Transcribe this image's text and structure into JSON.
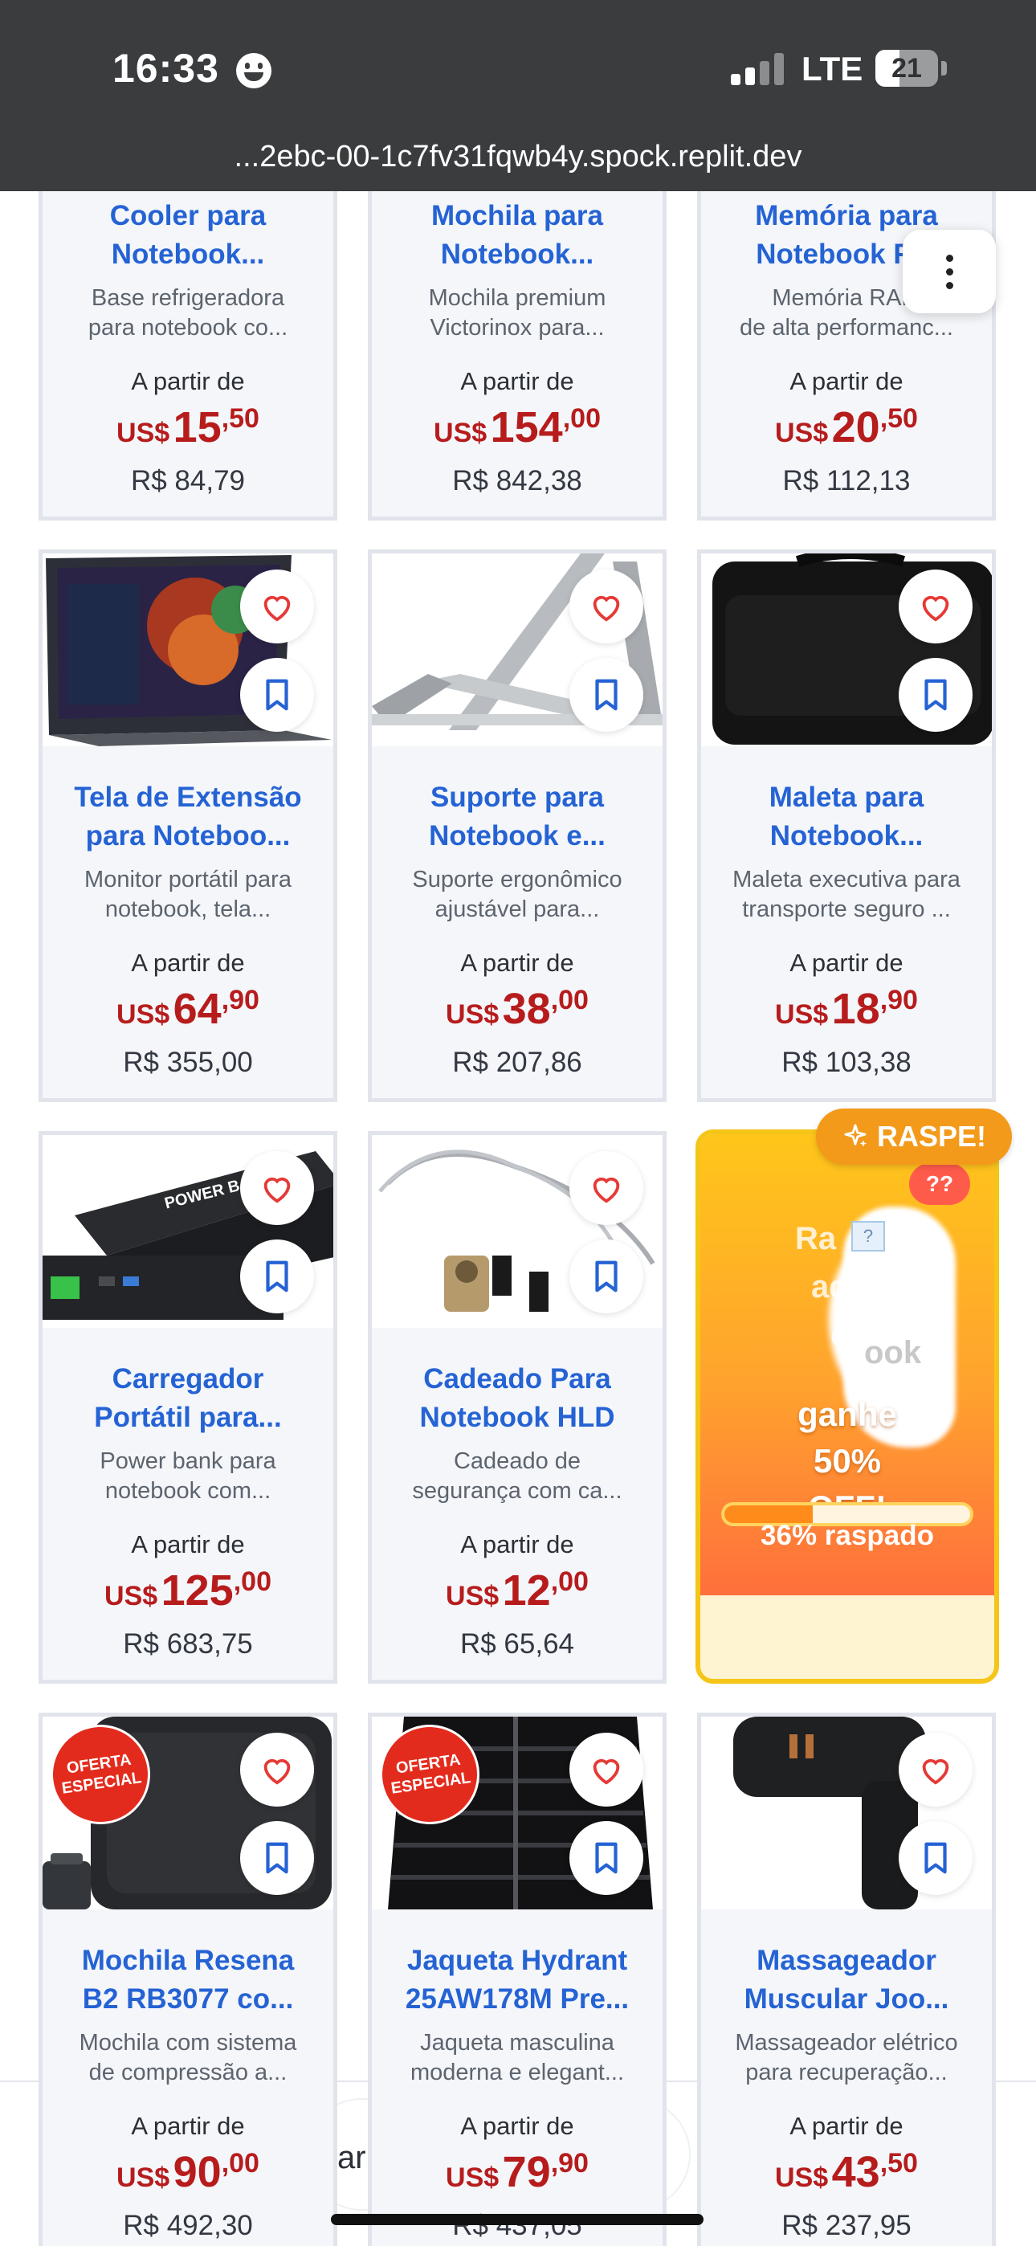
{
  "status_bar": {
    "time": "16:33",
    "network": "LTE",
    "battery": "21"
  },
  "browser": {
    "url": "...2ebc-00-1c7fv31fqwb4y.spock.replit.dev"
  },
  "common": {
    "price_prefix": "A partir de",
    "currency_usd": "US$"
  },
  "products": [
    {
      "title_l1": "Cooler para",
      "title_l2": "Notebook...",
      "desc_l1": "Base refrigeradora",
      "desc_l2": "para notebook co...",
      "usd_int": "15",
      "usd_cents": ",50",
      "brl": "R$ 84,79"
    },
    {
      "title_l1": "Mochila para",
      "title_l2": "Notebook...",
      "desc_l1": "Mochila premium",
      "desc_l2": "Victorinox para...",
      "usd_int": "154",
      "usd_cents": ",00",
      "brl": "R$ 842,38"
    },
    {
      "title_l1": "Memória para",
      "title_l2": "Notebook R...",
      "desc_l1": "Memória RAM",
      "desc_l2": "de alta performanc...",
      "usd_int": "20",
      "usd_cents": ",50",
      "brl": "R$ 112,13"
    },
    {
      "title_l1": "Tela de Extensão",
      "title_l2": "para Noteboo...",
      "desc_l1": "Monitor portátil para",
      "desc_l2": "notebook, tela...",
      "usd_int": "64",
      "usd_cents": ",90",
      "brl": "R$ 355,00",
      "image": "portable-monitor"
    },
    {
      "title_l1": "Suporte para",
      "title_l2": "Notebook e...",
      "desc_l1": "Suporte ergonômico",
      "desc_l2": "ajustável para...",
      "usd_int": "38",
      "usd_cents": ",00",
      "brl": "R$ 207,86",
      "image": "laptop-stand"
    },
    {
      "title_l1": "Maleta para",
      "title_l2": "Notebook...",
      "desc_l1": "Maleta executiva para",
      "desc_l2": "transporte seguro ...",
      "usd_int": "18",
      "usd_cents": ",90",
      "brl": "R$ 103,38",
      "image": "laptop-briefcase"
    },
    {
      "title_l1": "Carregador",
      "title_l2": "Portátil para...",
      "desc_l1": "Power bank para",
      "desc_l2": "notebook com...",
      "usd_int": "125",
      "usd_cents": ",00",
      "brl": "R$ 683,75",
      "image": "power-bank",
      "image_text": "POWER BANK"
    },
    {
      "title_l1": "Cadeado Para",
      "title_l2": "Notebook HLD",
      "desc_l1": "Cadeado de",
      "desc_l2": "segurança com ca...",
      "usd_int": "12",
      "usd_cents": ",00",
      "brl": "R$ 65,64",
      "image": "cable-lock"
    },
    {
      "title_l1": "Mochila Resena",
      "title_l2": "B2 RB3077 co...",
      "desc_l1": "Mochila com sistema",
      "desc_l2": "de compressão a...",
      "usd_int": "90",
      "usd_cents": ",00",
      "brl": "R$ 492,30",
      "badge": "OFERTA ESPECIAL",
      "image": "backpack"
    },
    {
      "title_l1": "Jaqueta Hydrant",
      "title_l2": "25AW178M Pre...",
      "desc_l1": "Jaqueta masculina",
      "desc_l2": "moderna e elegant...",
      "usd_int": "79",
      "usd_cents": ",90",
      "brl": "R$ 437,05",
      "badge": "OFERTA ESPECIAL",
      "image": "jacket"
    },
    {
      "title_l1": "Massageador",
      "title_l2": "Muscular Joo...",
      "desc_l1": "Massageador elétrico",
      "desc_l2": "para recuperação...",
      "usd_int": "43",
      "usd_cents": ",50",
      "brl": "R$ 237,95",
      "image": "massage-gun"
    }
  ],
  "scratch_card": {
    "label": "RASPE!",
    "mystery": "??",
    "hidden_lines": [
      "Ra",
      "aq",
      "e",
      "ook"
    ],
    "offer_lines": [
      "ganhe",
      "50%",
      "OFF!"
    ],
    "scratched_percent": 36,
    "progress_text": "36% raspado",
    "colors": {
      "border": "#f5c518",
      "label_bg": "#f39a1a"
    }
  },
  "bottom_bar": {
    "search_text": "ar"
  },
  "colors": {
    "title": "#2563d4",
    "price": "#b71c1c",
    "card_bg": "#f4f6fa"
  }
}
